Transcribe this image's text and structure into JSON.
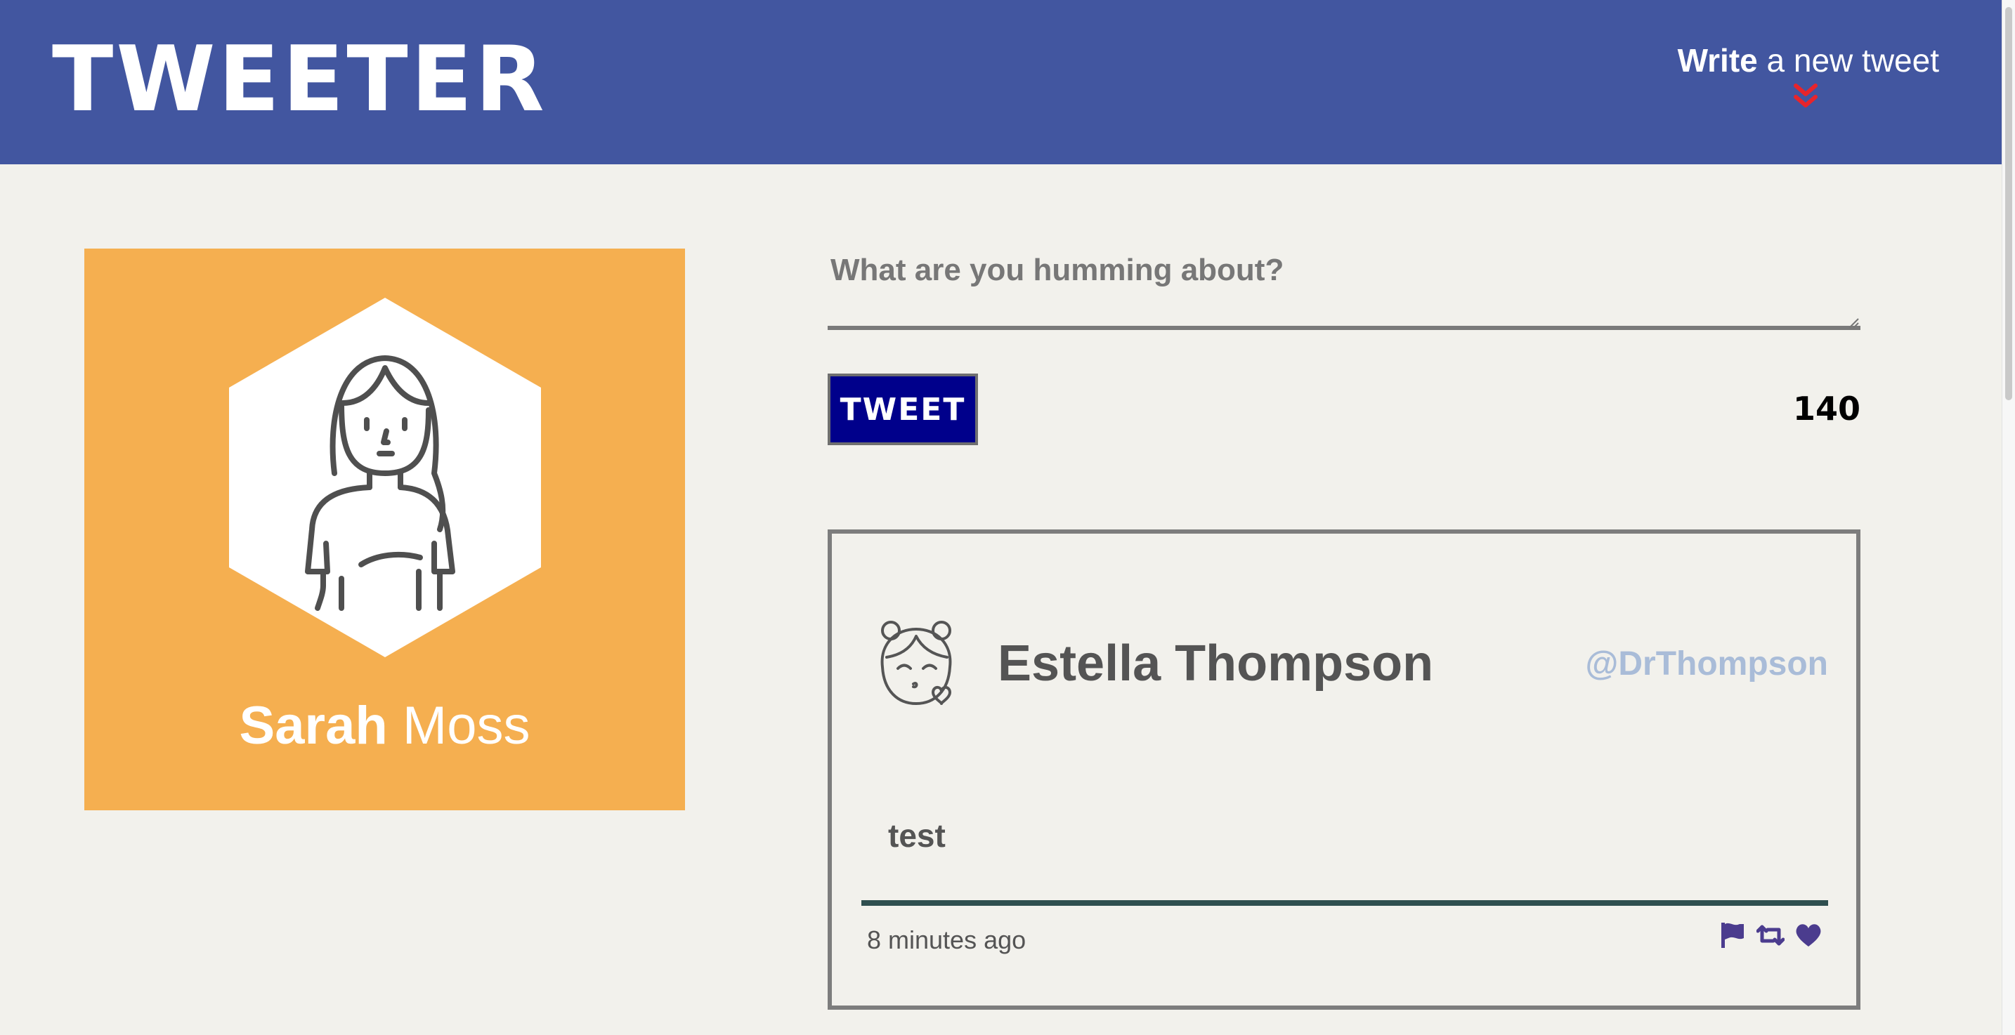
{
  "nav": {
    "brand": "TWEETER",
    "compose_bold": "Write",
    "compose_rest": " a new tweet",
    "compose_icon": "double-chevron-down-icon",
    "compose_icon_color": "#e8242b",
    "background": "#4256a0"
  },
  "profile": {
    "first_name": "Sarah",
    "last_name": " Moss",
    "avatar_icon": "user-avatar-woman-icon",
    "background": "#f5af50"
  },
  "composer": {
    "placeholder": "What are you humming about?",
    "value": "",
    "submit_label": "TWEET",
    "counter": "140"
  },
  "tweets": [
    {
      "author": "Estella Thompson",
      "handle": "@DrThompson",
      "content": "test",
      "time": "8 minutes ago",
      "avatar_icon": "girl-kiss-avatar-icon",
      "actions": [
        "flag-icon",
        "retweet-icon",
        "heart-icon"
      ],
      "action_color": "#4b3c8e"
    }
  ]
}
